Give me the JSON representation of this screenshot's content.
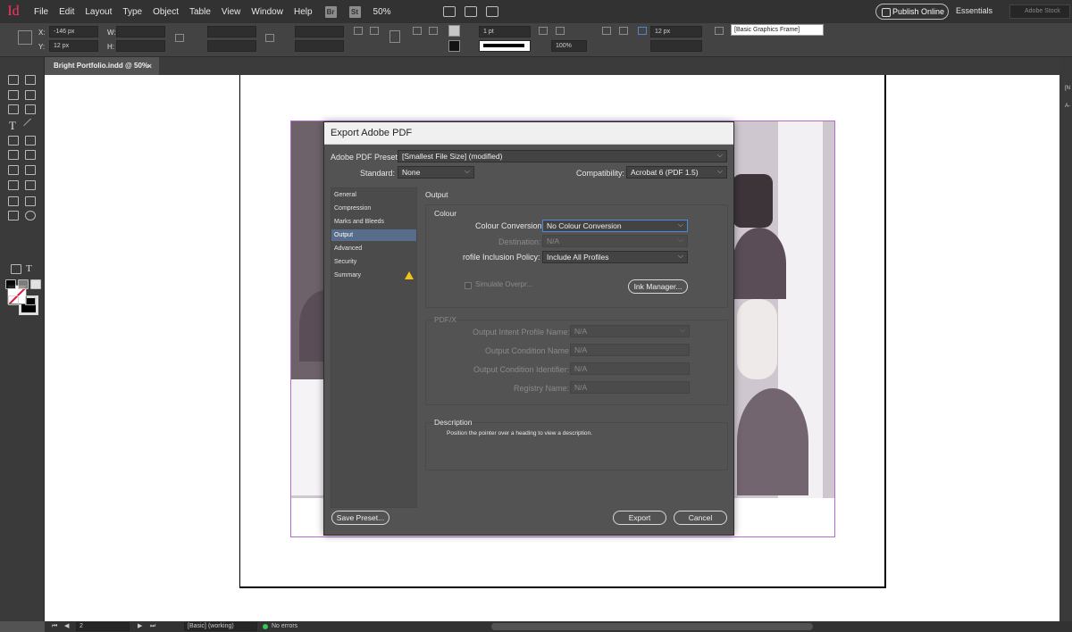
{
  "menubar": {
    "logo": "Id",
    "items": [
      "File",
      "Edit",
      "Layout",
      "Type",
      "Object",
      "Table",
      "View",
      "Window",
      "Help"
    ],
    "badges": [
      "Br",
      "St"
    ],
    "zoom": "50%",
    "publish_label": "Publish Online",
    "workspace_label": "Essentials",
    "stock_placeholder": "Adobe Stock"
  },
  "control": {
    "x_label": "X:",
    "x_value": "-146 px",
    "y_label": "Y:",
    "y_value": "12 px",
    "w_label": "W:",
    "h_label": "H:",
    "stroke_weight": "1 pt",
    "opacity": "100%",
    "corner_size": "12 px",
    "frame_style": "[Basic Graphics Frame]"
  },
  "document_tab": {
    "title": "Bright Portfolio.indd @ 50%",
    "close": "×"
  },
  "right_panel": {
    "label1": "[N",
    "label2": "A-"
  },
  "statusbar": {
    "page": "2",
    "master": "[Basic] (working)",
    "errors": "No errors"
  },
  "dialog": {
    "title": "Export Adobe PDF",
    "preset_label": "Adobe PDF Preset:",
    "preset_value": "[Smallest File Size] (modified)",
    "standard_label": "Standard:",
    "standard_value": "None",
    "compat_label": "Compatibility:",
    "compat_value": "Acrobat 6 (PDF 1.5)",
    "nav": [
      {
        "label": "General"
      },
      {
        "label": "Compression"
      },
      {
        "label": "Marks and Bleeds"
      },
      {
        "label": "Output"
      },
      {
        "label": "Advanced"
      },
      {
        "label": "Security"
      },
      {
        "label": "Summary"
      }
    ],
    "panel_title": "Output",
    "colour": {
      "title": "Colour",
      "conversion_label": "Colour Conversion:",
      "conversion_value": "No Colour Conversion",
      "destination_label": "Destination:",
      "destination_value": "N/A",
      "profile_label": "rofile Inclusion Policy:",
      "profile_value": "Include All Profiles",
      "simulate_label": "Simulate Overpr...",
      "ink_manager": "Ink Manager..."
    },
    "pdfx": {
      "title": "PDF/X",
      "intent_label": "Output Intent Profile Name:",
      "intent_value": "N/A",
      "condition_label": "Output Condition Name:",
      "condition_value": "N/A",
      "identifier_label": "Output Condition Identifier:",
      "identifier_value": "N/A",
      "registry_label": "Registry Name:",
      "registry_value": "N/A"
    },
    "description": {
      "title": "Description",
      "text": "Position the pointer over a heading to view a description."
    },
    "save_preset": "Save Preset...",
    "export": "Export",
    "cancel": "Cancel"
  },
  "colors": {
    "accent": "#566d8b",
    "warning": "#f2c314",
    "bleed": "#b46bd1",
    "logo": "#ff3366"
  }
}
